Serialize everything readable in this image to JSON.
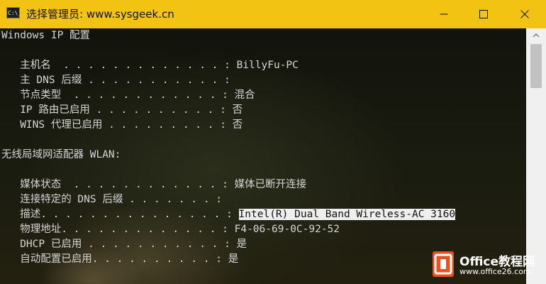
{
  "window": {
    "title": "选择管理员: www.sysgeek.cn",
    "icon_label": "C:\\_",
    "title_bar_color": "#f2c313"
  },
  "controls": {
    "minimize_icon": "minimize-icon",
    "maximize_icon": "maximize-icon",
    "close_icon": "close-icon"
  },
  "console": {
    "lines": [
      "Windows IP 配置",
      "",
      "   主机名  . . . . . . . . . . . . . : BillyFu-PC",
      "   主 DNS 后缀 . . . . . . . . . . . :",
      "   节点类型  . . . . . . . . . . . . : 混合",
      "   IP 路由已启用 . . . . . . . . . . : 否",
      "   WINS 代理已启用 . . . . . . . . . : 否",
      "",
      "无线局域网适配器 WLAN:",
      "",
      "   媒体状态  . . . . . . . . . . . . : 媒体已断开连接",
      "   连接特定的 DNS 后缀 . . . . . . . :",
      "   描述. . . . . . . . . . . . . . . : ",
      "   物理地址. . . . . . . . . . . . . : F4-06-69-0C-92-52",
      "   DHCP 已启用 . . . . . . . . . . . : 是",
      "   自动配置已启用. . . . . . . . . . : 是"
    ],
    "selected_text": "Intel(R) Dual Band Wireless-AC 3160"
  },
  "watermark": {
    "title": "Office教程网",
    "url": "www.office26.com",
    "brand_color": "#e8531d"
  }
}
